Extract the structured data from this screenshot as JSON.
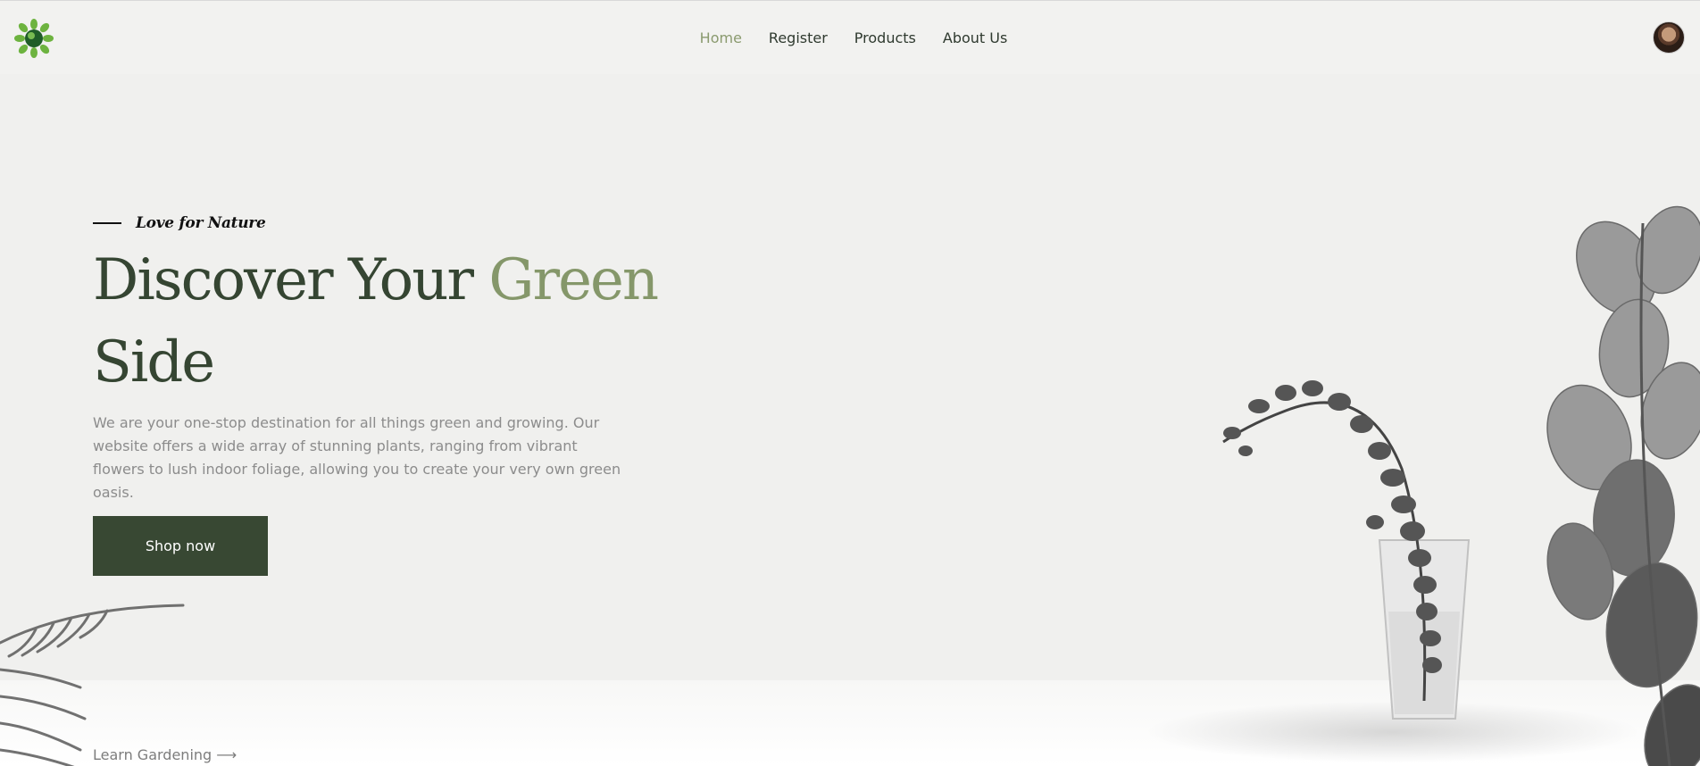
{
  "nav": {
    "links": [
      "Home",
      "Register",
      "Products",
      "About Us"
    ],
    "active": "Home"
  },
  "hero": {
    "eyebrow": "Love for Nature",
    "headline_part1": "Discover Your ",
    "headline_accent": "Green",
    "headline_part2": "Side",
    "description": "We are your one-stop destination for all things green and growing. Our website offers a wide array of stunning plants, ranging from vibrant flowers to lush indoor foliage, allowing you to create your very own green oasis.",
    "cta_label": "Shop now",
    "secondary_link": "Learn Gardening ⟶"
  },
  "colors": {
    "accent": "#85976a",
    "primary_dark": "#384833",
    "background": "#f0f0ee",
    "body_text": "#8c8c8c"
  },
  "icons": {
    "logo": "green-globe-leaf-logo",
    "avatar": "user-avatar-photo"
  }
}
